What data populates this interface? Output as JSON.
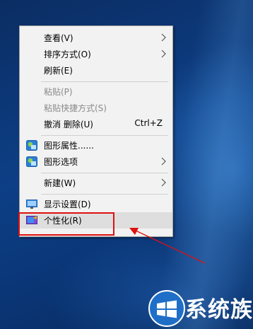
{
  "context_menu": {
    "items": [
      {
        "label": "查看(V)",
        "submenu": true
      },
      {
        "label": "排序方式(O)",
        "submenu": true
      },
      {
        "label": "刷新(E)"
      },
      {
        "label": "粘贴(P)",
        "disabled": true
      },
      {
        "label": "粘贴快捷方式(S)",
        "disabled": true
      },
      {
        "label": "撤消 删除(U)",
        "shortcut": "Ctrl+Z"
      },
      {
        "label": "图形属性......",
        "icon": "graphics-icon"
      },
      {
        "label": "图形选项",
        "icon": "graphics-icon",
        "submenu": true
      },
      {
        "label": "新建(W)",
        "submenu": true
      },
      {
        "label": "显示设置(D)",
        "icon": "display-settings-icon"
      },
      {
        "label": "个性化(R)",
        "icon": "personalize-icon",
        "highlighted": true
      }
    ]
  },
  "annotation": {
    "highlight_color": "#e01010"
  },
  "watermark": {
    "text": "系统族"
  }
}
